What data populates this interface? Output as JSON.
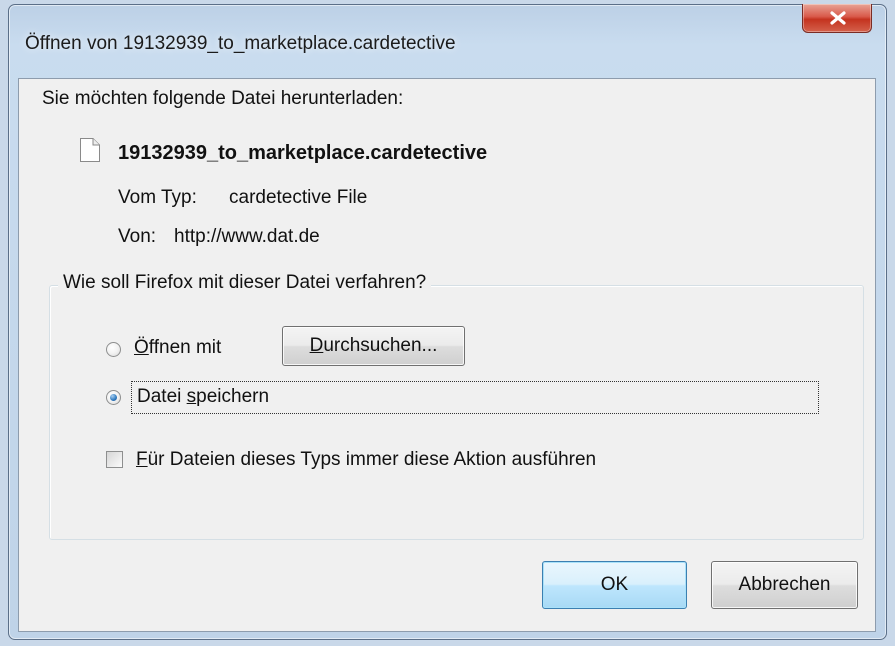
{
  "window": {
    "title": "Öffnen von 19132939_to_marketplace.cardetective"
  },
  "dialog": {
    "prompt": "Sie möchten folgende Datei herunterladen:",
    "file": {
      "name": "19132939_to_marketplace.cardetective",
      "icon": "file-icon",
      "type_label": "Vom Typ:",
      "type_value": "cardetective File",
      "source_label": "Von:",
      "source_value": "http://www.dat.de"
    },
    "action_group": {
      "legend": "Wie soll Firefox mit dieser Datei verfahren?",
      "open_with": {
        "accesskey": "Ö",
        "label_rest": "ffnen mit",
        "selected": false
      },
      "browse_button": {
        "accesskey": "D",
        "label_rest": "urchsuchen..."
      },
      "save_file": {
        "label_start": "Datei ",
        "accesskey": "s",
        "label_rest": "peichern",
        "selected": true
      },
      "always_checkbox": {
        "accesskey": "F",
        "label_rest": "ür Dateien dieses Typs immer diese Aktion ausführen",
        "checked": false
      }
    },
    "buttons": {
      "ok": "OK",
      "cancel": "Abbrechen"
    }
  },
  "colors": {
    "default_button_border": "#3c7fb1",
    "close_button": "#c4331f",
    "dialog_background": "#f0f0f0"
  }
}
